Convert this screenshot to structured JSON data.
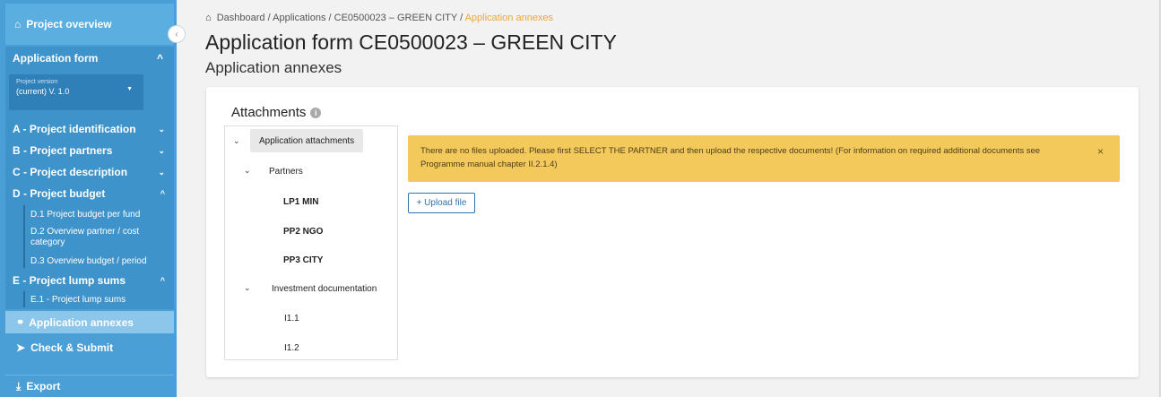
{
  "sidebar": {
    "overview": {
      "label": "Project overview",
      "icon": "home-icon"
    },
    "collapse_icon": "‹",
    "application_form": {
      "label": "Application form",
      "chevron": "^"
    },
    "version": {
      "label": "Project version",
      "value": "(current) V. 1.0",
      "arrow": "▼"
    },
    "items": [
      {
        "label": "A - Project identification",
        "chevron": "⌄"
      },
      {
        "label": "B - Project partners",
        "chevron": "⌄"
      },
      {
        "label": "C - Project description",
        "chevron": "⌄"
      },
      {
        "label": "D - Project budget",
        "chevron": "^"
      },
      {
        "label": "E - Project lump sums",
        "chevron": "^"
      }
    ],
    "budget_subitems": [
      {
        "label": "D.1 Project budget per fund"
      },
      {
        "label": "D.2 Overview partner / cost category"
      },
      {
        "label": "D.3 Overview budget / period"
      }
    ],
    "lumpsum_subitems": [
      {
        "label": "E.1 - Project lump sums"
      }
    ],
    "annexes": {
      "label": "Application annexes",
      "icon": "link-icon"
    },
    "check_submit": {
      "label": "Check & Submit",
      "icon": "send-icon"
    },
    "export": {
      "label": "Export",
      "icon": "download-icon"
    }
  },
  "breadcrumb": {
    "items": [
      "Dashboard",
      "Applications",
      "CE0500023 – GREEN CITY"
    ],
    "separator": "/",
    "current": "Application annexes"
  },
  "page": {
    "title": "Application form CE0500023 – GREEN CITY",
    "subtitle": "Application annexes"
  },
  "attachments": {
    "title": "Attachments",
    "info_icon": "i",
    "tree": {
      "root": "Application attachments",
      "partners": "Partners",
      "partner_items": [
        "LP1 MIN",
        "PP2 NGO",
        "PP3 CITY"
      ],
      "investment": "Investment documentation",
      "investment_items": [
        "I1.1",
        "I1.2"
      ]
    },
    "alert": {
      "message": "There are no files uploaded. Please first SELECT THE PARTNER and then upload the respective documents! (For information on required additional documents see Programme manual chapter II.2.1.4)",
      "close": "×",
      "color": "#f4c95b"
    },
    "upload_button": "+ Upload file"
  },
  "colors": {
    "sidebar": "#4a9fd6",
    "accent": "#f0a53a",
    "primary": "#2f72b0"
  }
}
